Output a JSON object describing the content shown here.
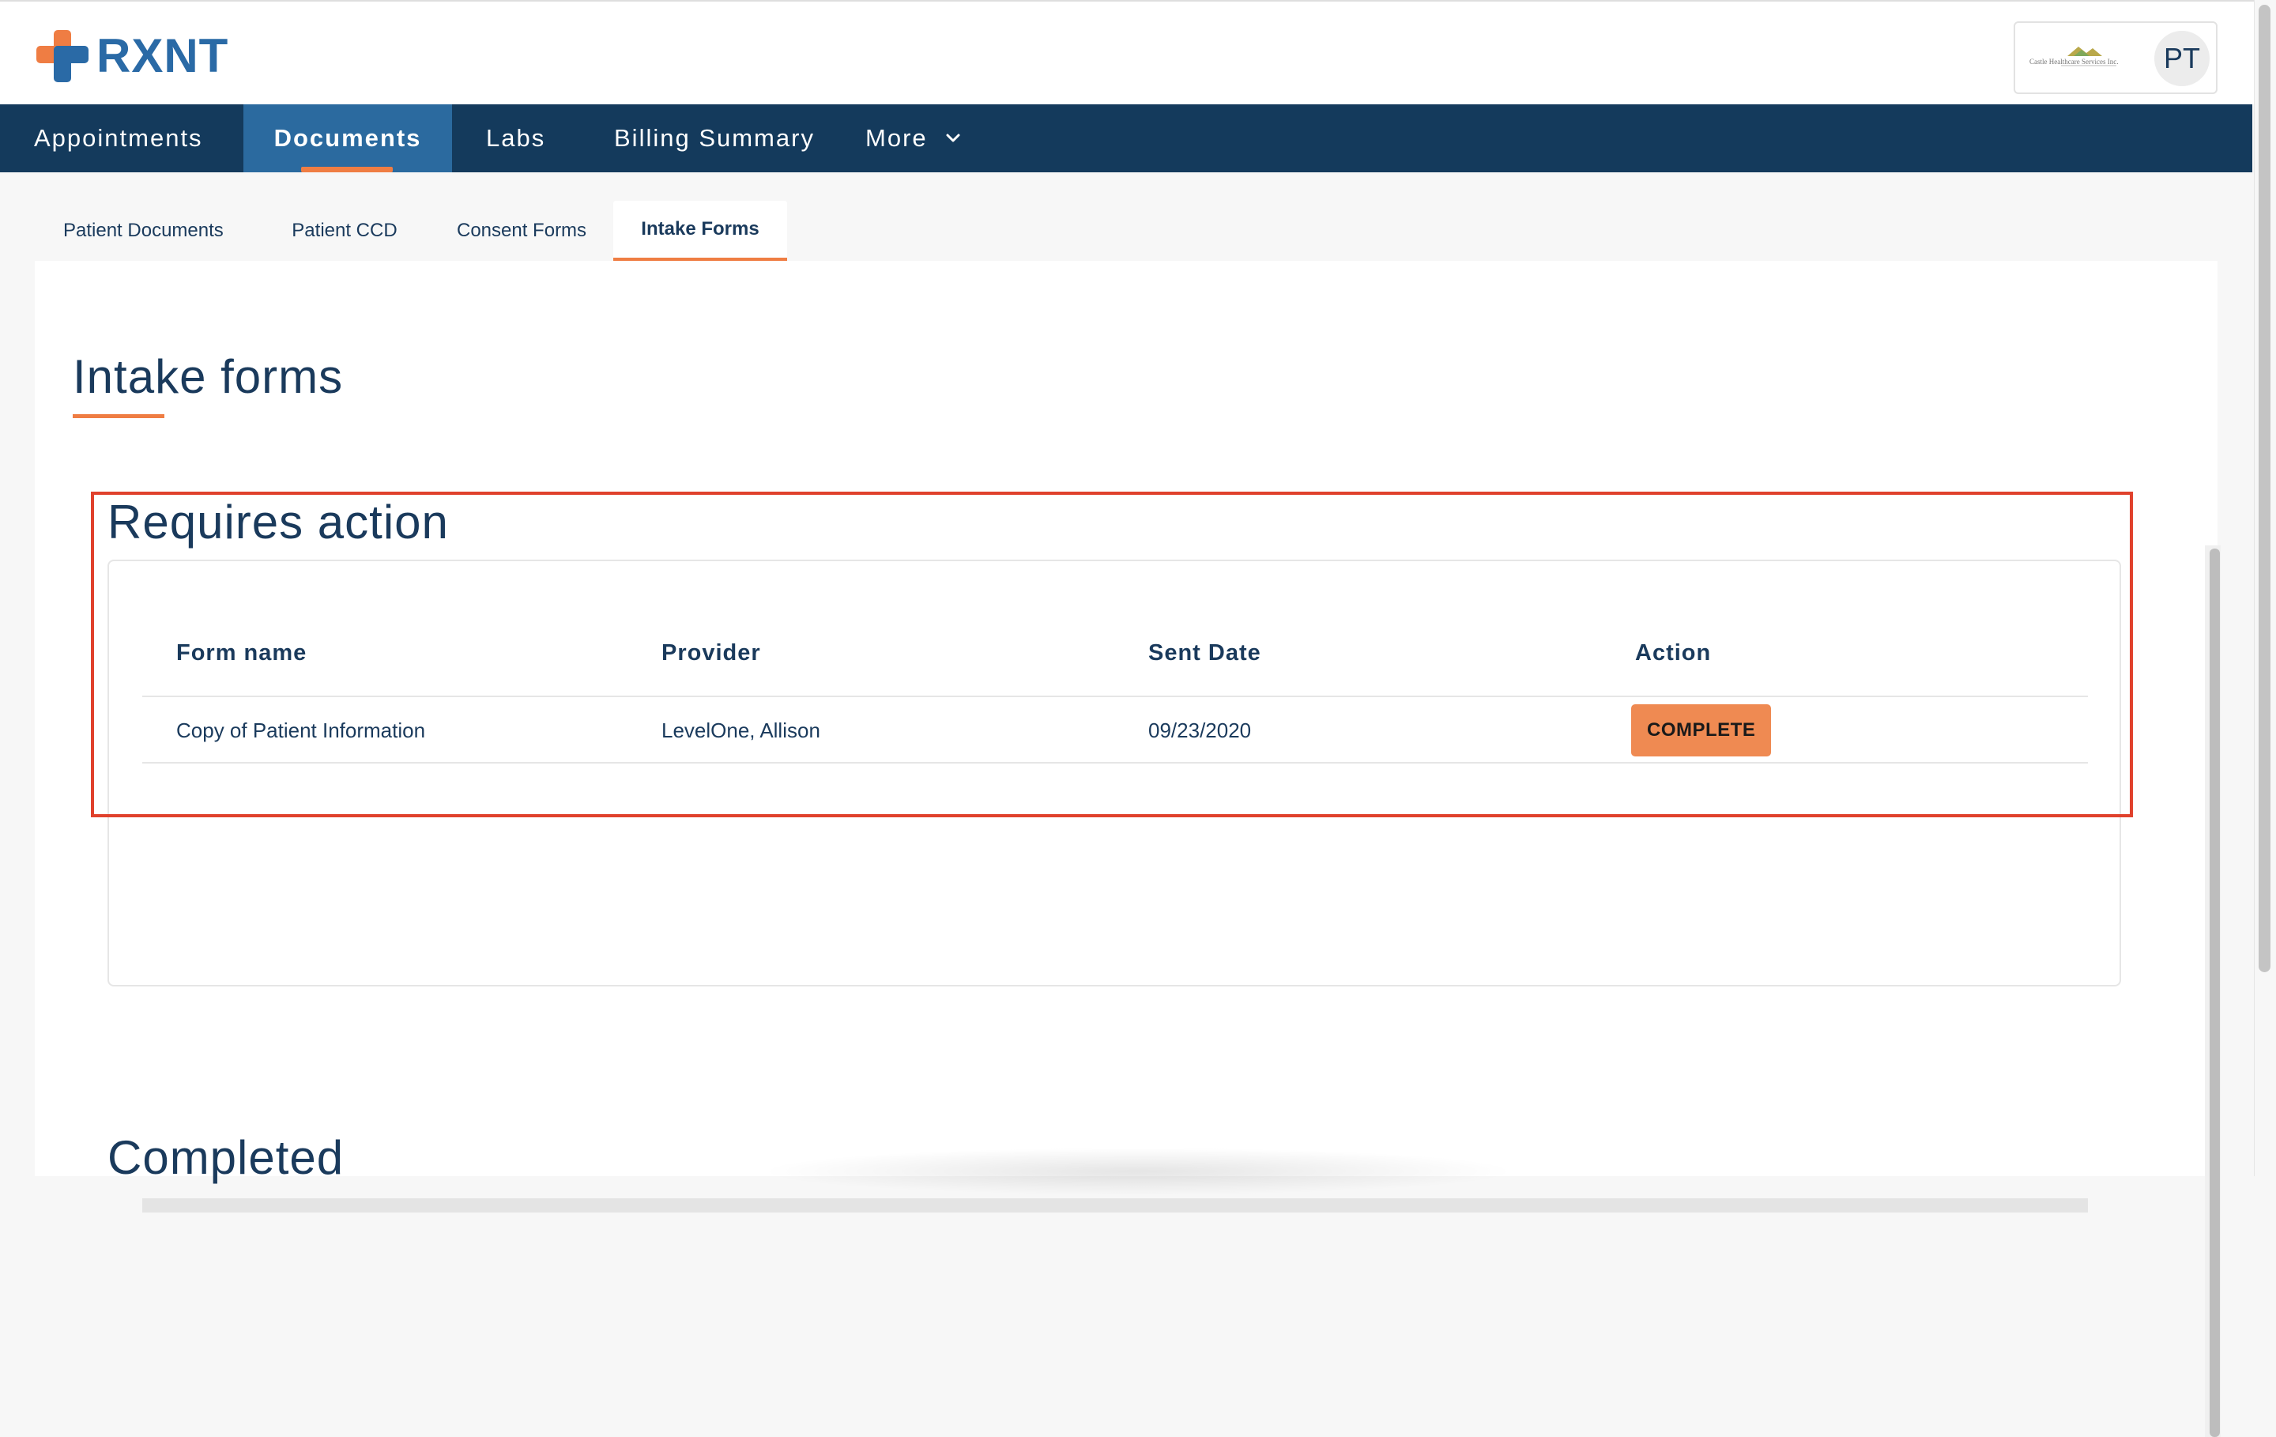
{
  "header": {
    "logo_text": "RXNT",
    "practice_name": "Castle Healthcare Services Inc.",
    "avatar_initials": "PT"
  },
  "nav": {
    "items": [
      {
        "label": "Appointments",
        "active": false
      },
      {
        "label": "Documents",
        "active": true
      },
      {
        "label": "Labs",
        "active": false
      },
      {
        "label": "Billing Summary",
        "active": false
      },
      {
        "label": "More",
        "active": false
      }
    ]
  },
  "subtabs": [
    {
      "label": "Patient Documents",
      "active": false
    },
    {
      "label": "Patient CCD",
      "active": false
    },
    {
      "label": "Consent Forms",
      "active": false
    },
    {
      "label": "Intake Forms",
      "active": true
    }
  ],
  "page": {
    "title": "Intake forms",
    "requires_action": {
      "title": "Requires action",
      "columns": [
        "Form name",
        "Provider",
        "Sent Date",
        "Action"
      ],
      "rows": [
        {
          "form_name": "Copy of Patient Information",
          "provider": "LevelOne, Allison",
          "sent_date": "09/23/2020",
          "action_label": "COMPLETE"
        }
      ]
    },
    "completed": {
      "title": "Completed"
    }
  },
  "colors": {
    "nav_bg": "#143a5c",
    "nav_active_bg": "#2b6a9f",
    "accent": "#ef7d43",
    "text": "#1a3a5c",
    "highlight": "#e0412c"
  },
  "icons": {
    "more_dropdown": "chevron-down-icon"
  }
}
